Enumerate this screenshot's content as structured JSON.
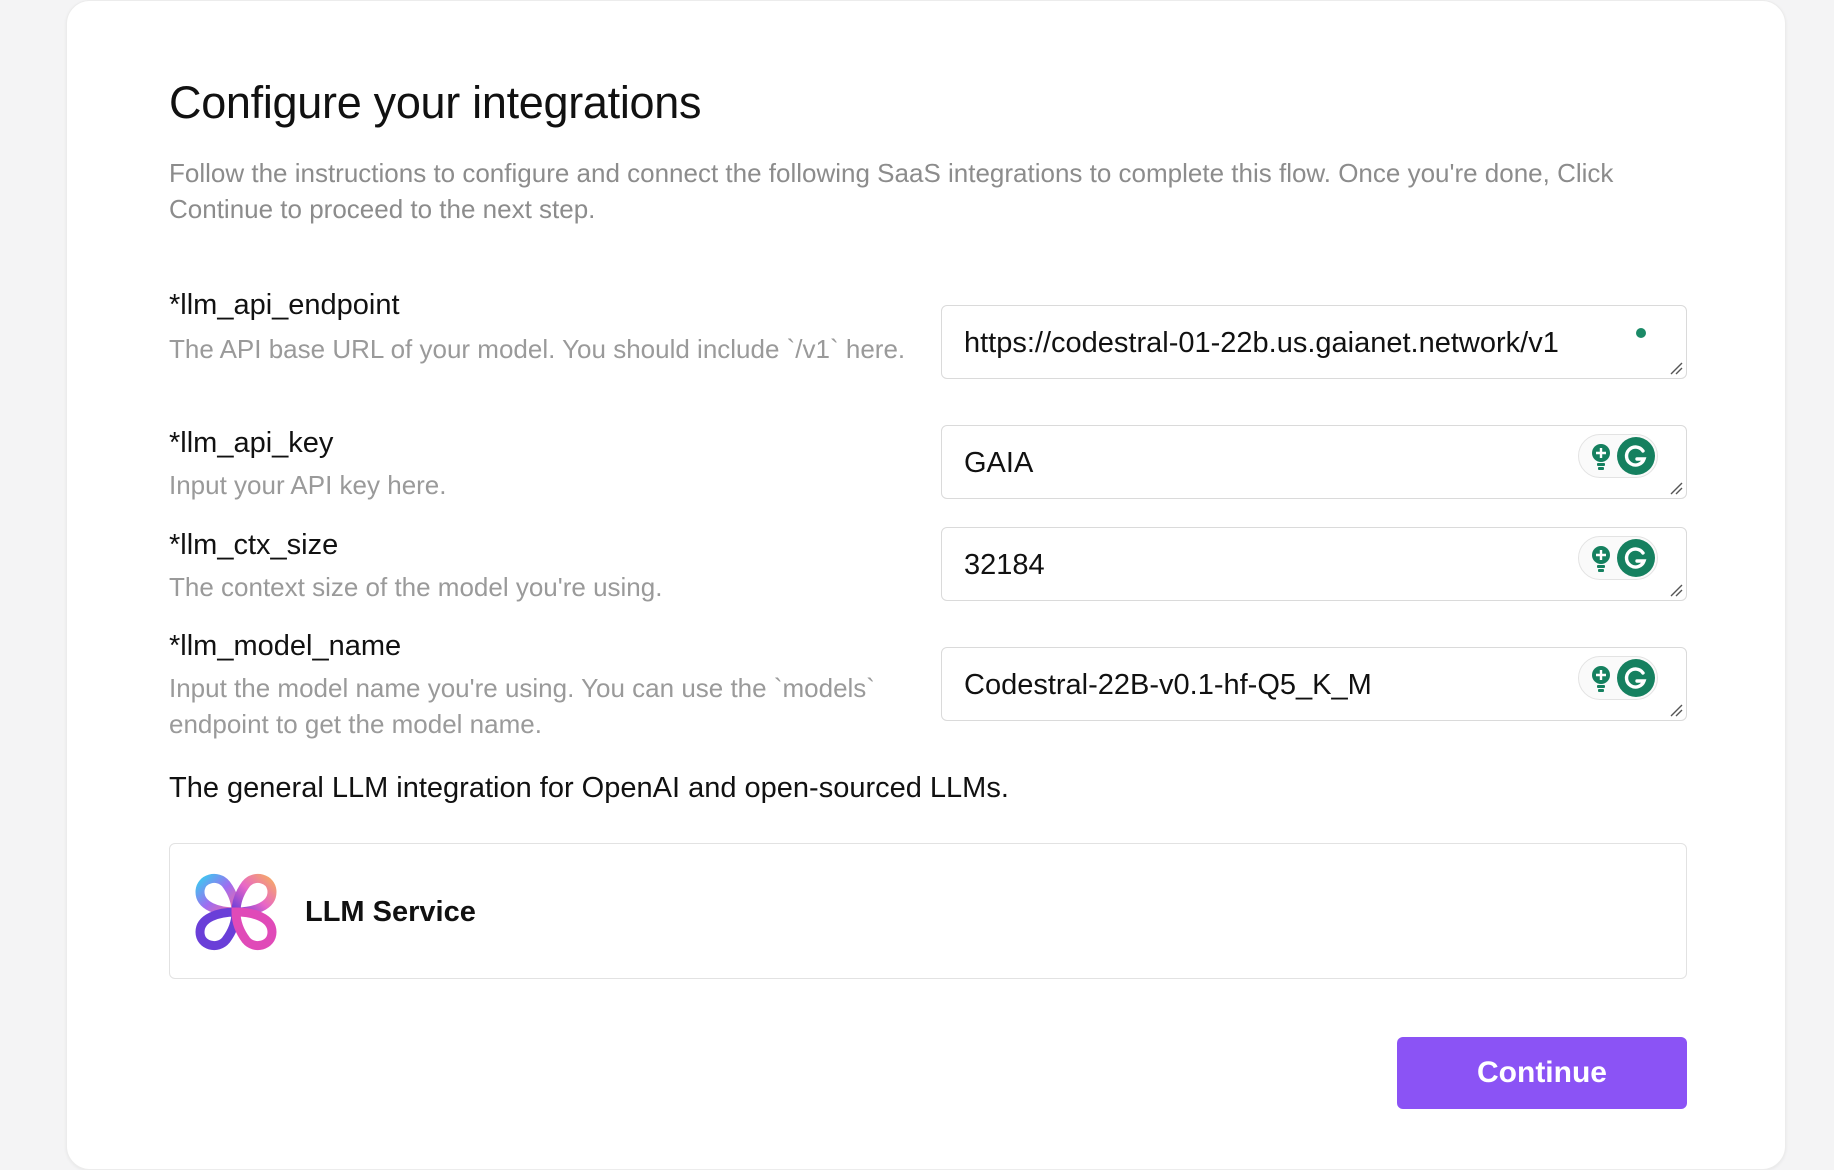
{
  "page": {
    "title": "Configure your integrations",
    "intro": "Follow the instructions to configure and connect the following SaaS integrations to complete this flow. Once you're done, Click Continue to proceed to the next step."
  },
  "fields": [
    {
      "label": "*llm_api_endpoint",
      "description": "The API base URL of your model. You should include `/v1` here.",
      "value": "https://codestral-01-22b.us.gaianet.network/v1"
    },
    {
      "label": "*llm_api_key",
      "description": "Input your API key here.",
      "value": "GAIA"
    },
    {
      "label": "*llm_ctx_size",
      "description": "The context size of the model you're using.",
      "value": "32184"
    },
    {
      "label": "*llm_model_name",
      "description": "Input the model name you're using. You can use the `models` endpoint to get the model name.",
      "value": "Codestral-22B-v0.1-hf-Q5_K_M"
    }
  ],
  "integration": {
    "summary": "The general LLM integration for OpenAI and open-sourced LLMs.",
    "service_name": "LLM Service",
    "logo_icon": "llm-service-logo-icon"
  },
  "actions": {
    "continue_label": "Continue"
  },
  "colors": {
    "accent": "#8b53f5",
    "assistant_green": "#15805f",
    "muted_text": "#9a9a9a"
  },
  "icons": {
    "status_dot": "status-dot-icon",
    "assistant": "grammarly-icon",
    "suggestion": "lightbulb-icon",
    "resize": "resize-handle-icon"
  }
}
